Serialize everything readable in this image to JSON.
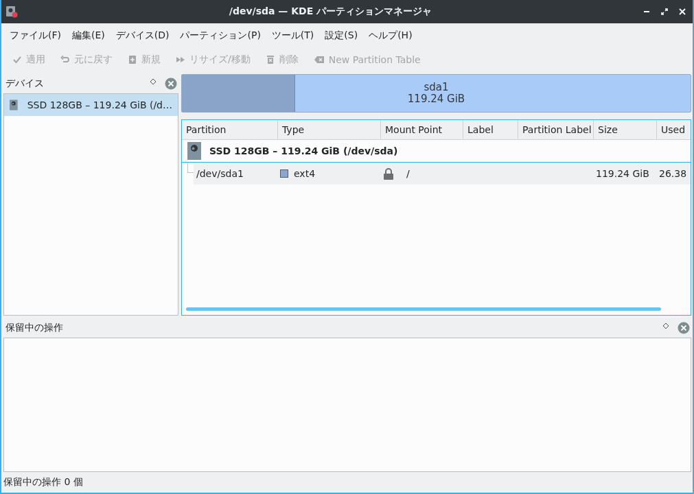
{
  "window": {
    "title": "/dev/sda — KDE パーティションマネージャ"
  },
  "menu": [
    "ファイル(F)",
    "編集(E)",
    "デバイス(D)",
    "パーティション(P)",
    "ツール(T)",
    "設定(S)",
    "ヘルプ(H)"
  ],
  "toolbar": [
    {
      "label": "適用",
      "kind": "check",
      "disabled": true
    },
    {
      "label": "元に戻す",
      "kind": "undo",
      "disabled": true
    },
    {
      "label": "新規",
      "kind": "new",
      "disabled": true
    },
    {
      "label": "リサイズ/移動",
      "kind": "resize",
      "disabled": true
    },
    {
      "label": "削除",
      "kind": "delete",
      "disabled": true
    },
    {
      "label": "New Partition Table",
      "kind": "table",
      "disabled": true
    }
  ],
  "devices_panel": {
    "title": "デバイス",
    "items": [
      {
        "label": "SSD 128GB – 119.24 GiB (/d…",
        "selected": true
      }
    ]
  },
  "partition_bar": [
    {
      "name": "sda1",
      "size": "119.24 GiB",
      "level": 0.221
    }
  ],
  "table": {
    "columns": [
      "Partition",
      "Type",
      "Mount Point",
      "Label",
      "Partition Label",
      "Size",
      "Used"
    ],
    "device": "SSD 128GB – 119.24 GiB (/dev/sda)",
    "rows": [
      {
        "partition": "/dev/sda1",
        "type": "ext4",
        "color": "#8ea6cc",
        "mounted": true,
        "mount_point": "/",
        "size": "119.24 GiB",
        "used": "26.38"
      }
    ]
  },
  "pending_panel": {
    "title": "保留中の操作"
  },
  "status_bar": "保留中の操作 0 個"
}
